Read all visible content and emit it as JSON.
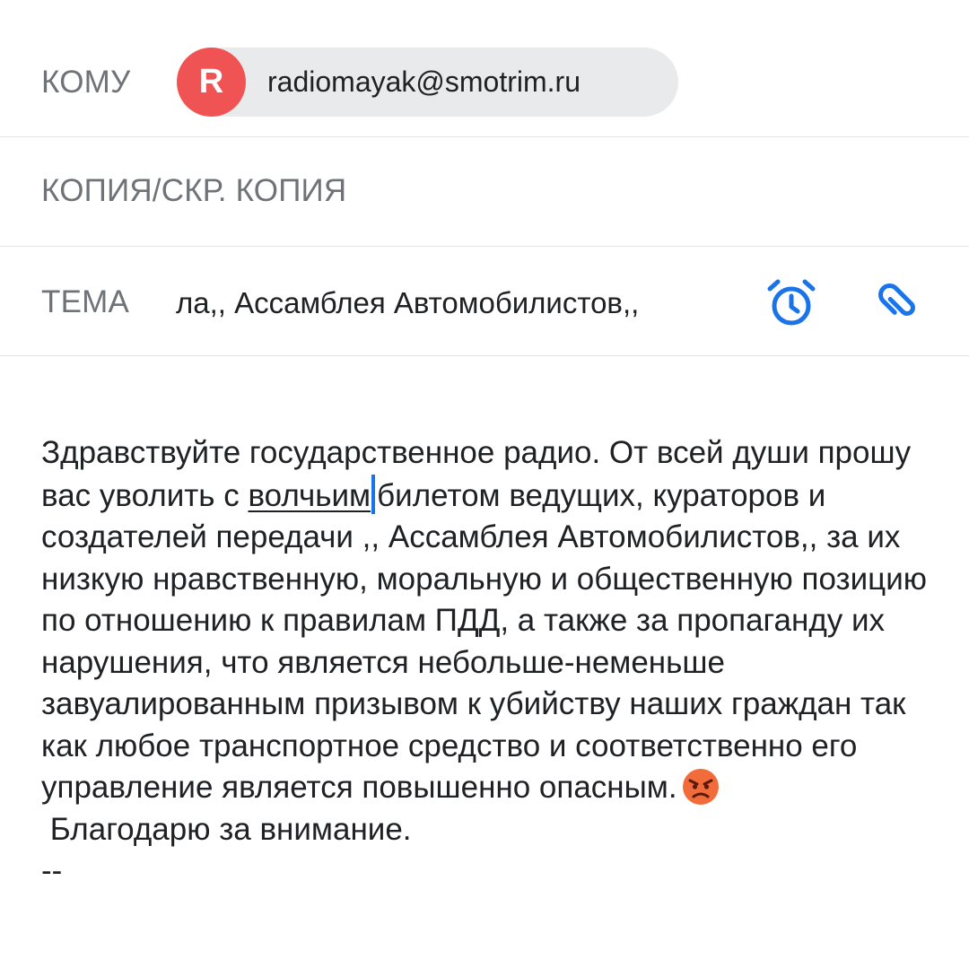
{
  "to": {
    "label": "КОМУ",
    "recipient": {
      "avatar_letter": "R",
      "avatar_color": "#f05353",
      "email": "radiomayak@smotrim.ru"
    }
  },
  "cc": {
    "label": "КОПИЯ/СКР. КОПИЯ"
  },
  "subject": {
    "label": "ТЕМА",
    "value": "ла,, Ассамблея Автомобилистов,,",
    "icons": [
      "alarm-clock-icon",
      "attachment-icon"
    ]
  },
  "body": {
    "before_underline": "Здравствуйте государственное радио. От всей души прошу вас уволить с ",
    "underlined_word": "волчьим",
    "after_underline": "билетом ведущих, кураторов и создателей передачи ,, Ассамблея Автомобилистов,, за их низкую нравственную, моральную и общественную позицию по отношению к правилам ПДД, а также за пропаганду их нарушения, что является небольше-неменьше завуалированным призывом к убийству наших граждан так как любое транспортное средство и соответственно его управление является повышенно опасным.",
    "emoji": "angry-face-emoji",
    "closing": " Благодарю за внимание.",
    "signature_separator": "--"
  },
  "colors": {
    "accent": "#1a73e8",
    "label": "#6f7378",
    "chip_bg": "#e9eaec"
  }
}
